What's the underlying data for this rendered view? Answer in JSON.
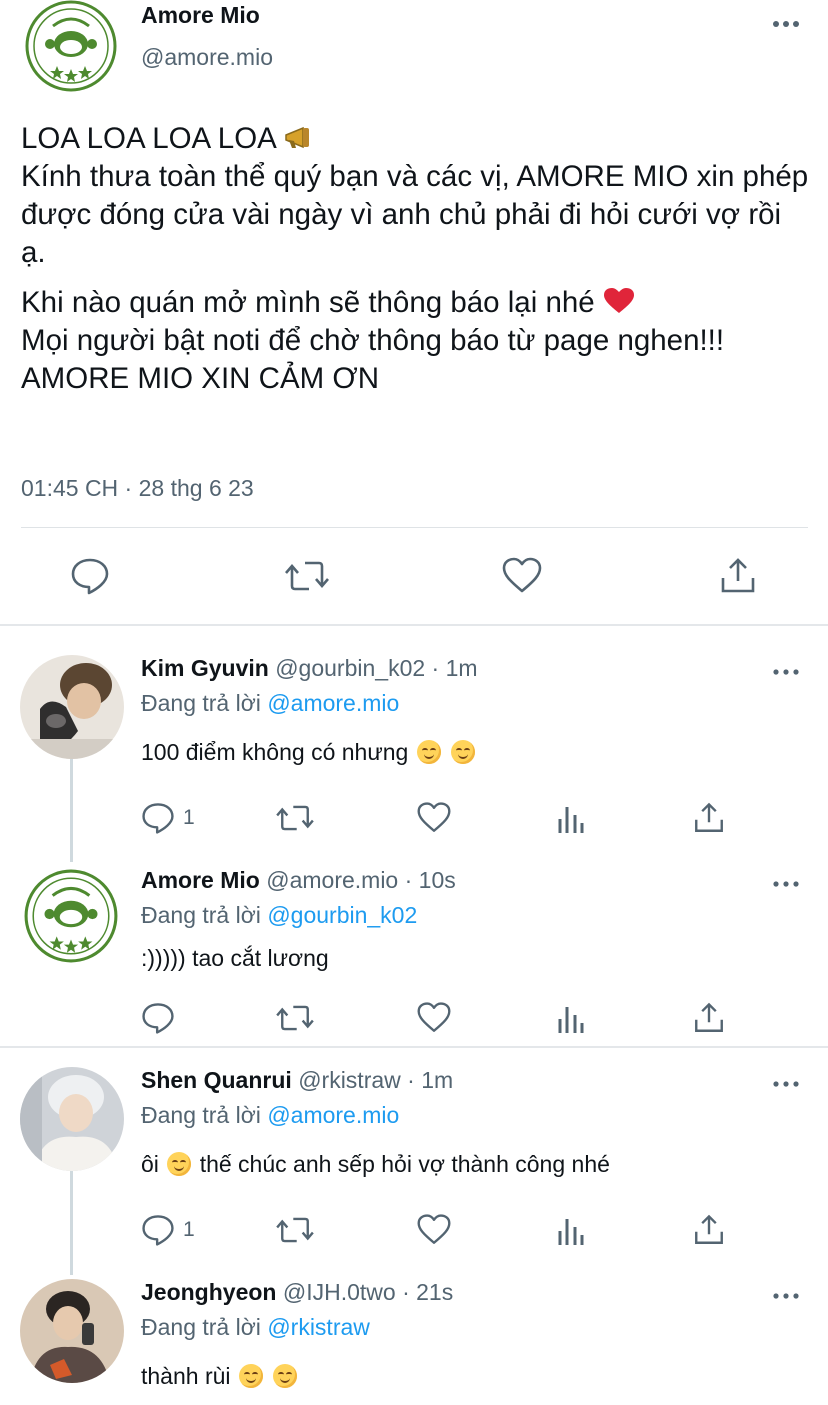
{
  "main_tweet": {
    "display_name": "Amore Mio",
    "handle": "@amore.mio",
    "line1_text": "LOA LOA LOA LOA",
    "line1_emoji": "megaphone-icon",
    "para1_rest": "Kính thưa toàn thể quý bạn và các vị, AMORE MIO xin phép được đóng cửa vài ngày vì anh chủ phải đi hỏi cưới vợ rồi ạ.",
    "para2_text": "Khi nào quán mở mình sẽ thông báo lại nhé",
    "para2_emoji": "red-heart-icon",
    "para3_text": "Mọi người bật noti để chờ thông báo từ page nghen!!!",
    "para4_text": "AMORE MIO XIN CẢM ƠN",
    "timestamp": "01:45 CH · 28 thg 6 23"
  },
  "replies": [
    {
      "display_name": "Kim Gyuvin",
      "meta": "@gourbin_k02 · 1m",
      "replying_prefix": "Đang trả lời",
      "replying_to": "@amore.mio",
      "text": "100 điểm không có nhưng",
      "reply_count": "1"
    },
    {
      "display_name": "Amore Mio",
      "meta": "@amore.mio · 10s",
      "replying_prefix": "Đang trả lời",
      "replying_to": "@gourbin_k02",
      "text": ":))))) tao cắt lương",
      "reply_count": ""
    },
    {
      "display_name": "Shen Quanrui",
      "meta": "@rkistraw · 1m",
      "replying_prefix": "Đang trả lời",
      "replying_to": "@amore.mio",
      "text_before": "ôi",
      "text_after": "thế chúc anh sếp hỏi vợ thành công nhé",
      "reply_count": "1"
    },
    {
      "display_name": "Jeonghyeon",
      "meta": "@IJH.0two · 21s",
      "replying_prefix": "Đang trả lời",
      "replying_to": "@rkistraw",
      "text": "thành rùi",
      "reply_count": ""
    }
  ],
  "colors": {
    "text": "#0f1419",
    "secondary": "#536471",
    "link": "#1d9bf0",
    "logo_green": "#4e8a2f"
  }
}
